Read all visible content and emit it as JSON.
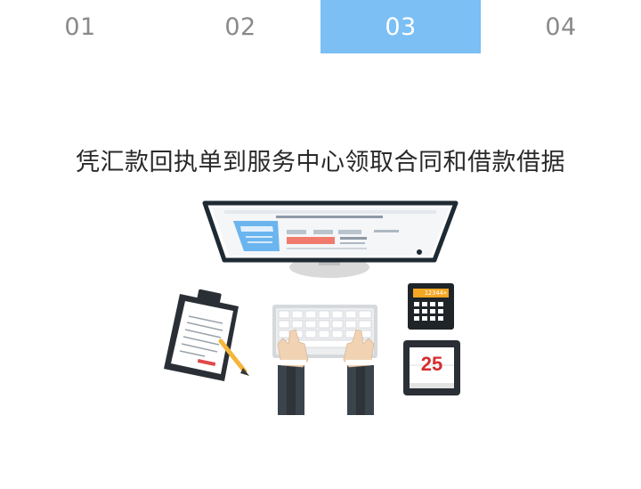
{
  "tabs": [
    {
      "label": "01",
      "active": false
    },
    {
      "label": "02",
      "active": false
    },
    {
      "label": "03",
      "active": true
    },
    {
      "label": "04",
      "active": false
    }
  ],
  "headline": "凭汇款回执单到服务中心领取合同和借款借据",
  "illustration": {
    "calculator_display": "12344+",
    "calendar_day": "25"
  },
  "colors": {
    "active_tab": "#7bbff5",
    "tab_text": "#8a8a8a",
    "active_tab_text": "#ffffff",
    "headline": "#2a2a2a",
    "calendar_number": "#d62d2d",
    "calculator_display": "#f5a623"
  },
  "icons": [
    "monitor-icon",
    "clipboard-icon",
    "pencil-icon",
    "keyboard-icon",
    "hands-icon",
    "calculator-icon",
    "calendar-icon"
  ]
}
